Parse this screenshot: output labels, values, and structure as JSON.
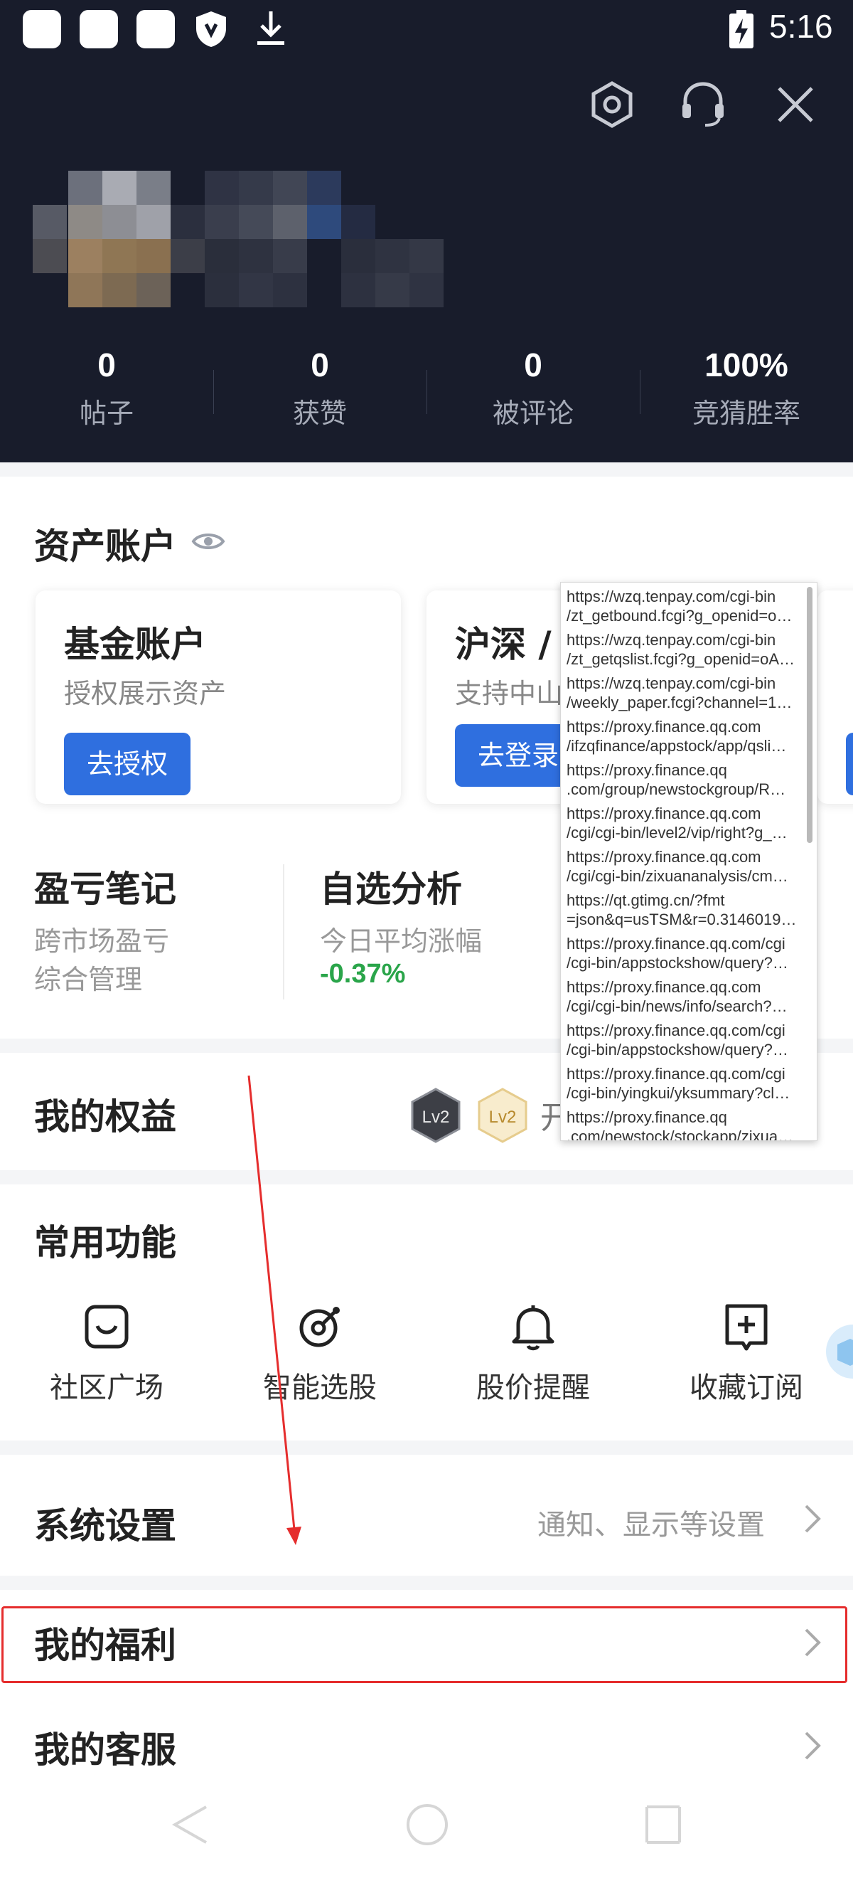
{
  "status_bar": {
    "time": "5:16",
    "icons": [
      "app-icon",
      "app-icon",
      "app-icon",
      "shield-icon",
      "download-icon",
      "battery-charging-icon"
    ]
  },
  "header": {
    "icons": [
      "settings-hexagon-icon",
      "headset-icon",
      "close-icon"
    ],
    "stats": [
      {
        "value": "0",
        "label": "帖子"
      },
      {
        "value": "0",
        "label": "获赞"
      },
      {
        "value": "0",
        "label": "被评论"
      },
      {
        "value": "100%",
        "label": "竞猜胜率"
      }
    ]
  },
  "assets": {
    "title": "资产账户",
    "cards": [
      {
        "title": "基金账户",
        "subtitle": "授权展示资产",
        "button": "去授权"
      },
      {
        "title": "沪深 /",
        "subtitle": "支持中山",
        "button": "去登录"
      }
    ],
    "notes": [
      {
        "title": "盈亏笔记",
        "lines": [
          "跨市场盈亏",
          "综合管理"
        ]
      },
      {
        "title": "自选分析",
        "lines": [
          "今日平均涨幅"
        ],
        "value": "-0.37%"
      }
    ]
  },
  "rights": {
    "title": "我的权益",
    "badges": [
      "Lv2",
      "Lv2"
    ],
    "tail": "开"
  },
  "functions": {
    "title": "常用功能",
    "items": [
      {
        "label": "社区广场",
        "icon": "smile-box-icon"
      },
      {
        "label": "智能选股",
        "icon": "magic-select-icon"
      },
      {
        "label": "股价提醒",
        "icon": "bell-icon"
      },
      {
        "label": "收藏订阅",
        "icon": "bookmark-add-icon"
      }
    ]
  },
  "system": {
    "title": "系统设置",
    "detail": "通知、显示等设置"
  },
  "welfare": {
    "title": "我的福利"
  },
  "service": {
    "title": "我的客服"
  },
  "nav": {
    "icons": [
      "back-icon",
      "home-icon",
      "recents-icon"
    ]
  },
  "url_popup": {
    "items": [
      {
        "line1": "https://wzq.tenpay.com/cgi-bin",
        "line2": "/zt_getbound.fcgi?g_openid=o…"
      },
      {
        "line1": "https://wzq.tenpay.com/cgi-bin",
        "line2": "/zt_getqslist.fcgi?g_openid=oA…"
      },
      {
        "line1": "https://wzq.tenpay.com/cgi-bin",
        "line2": "/weekly_paper.fcgi?channel=1…"
      },
      {
        "line1": "https://proxy.finance.qq.com",
        "line2": "/ifzqfinance/appstock/app/qsli…"
      },
      {
        "line1": "https://proxy.finance.qq",
        "line2": ".com/group/newstockgroup/R…"
      },
      {
        "line1": "https://proxy.finance.qq.com",
        "line2": "/cgi/cgi-bin/level2/vip/right?g_…"
      },
      {
        "line1": "https://proxy.finance.qq.com",
        "line2": "/cgi/cgi-bin/zixuananalysis/cm…"
      },
      {
        "line1": "https://qt.gtimg.cn/?fmt",
        "line2": "=json&q=usTSM&r=0.3146019…"
      },
      {
        "line1": "https://proxy.finance.qq.com/cgi",
        "line2": "/cgi-bin/appstockshow/query?…"
      },
      {
        "line1": "https://proxy.finance.qq.com",
        "line2": "/cgi/cgi-bin/news/info/search?…"
      },
      {
        "line1": "https://proxy.finance.qq.com/cgi",
        "line2": "/cgi-bin/appstockshow/query?…"
      },
      {
        "line1": "https://proxy.finance.qq.com/cgi",
        "line2": "/cgi-bin/yingkui/yksummary?cl…"
      },
      {
        "line1": "https://proxy.finance.qq",
        "line2": ".com/newstock/stockapp/zixua…"
      }
    ]
  },
  "colors": {
    "header_bg": "#181c2b",
    "accent_blue": "#2f6fdf",
    "positive_green": "#2aa54a",
    "highlight_red": "#e52d2d"
  }
}
